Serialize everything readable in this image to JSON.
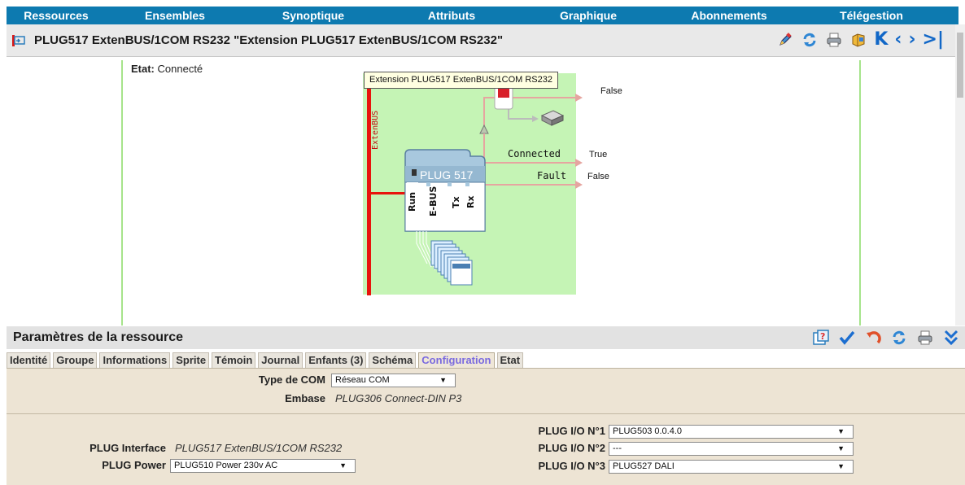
{
  "nav": {
    "items": [
      "Ressources",
      "Ensembles",
      "Synoptique",
      "Attributs",
      "Graphique",
      "Abonnements",
      "Télégestion"
    ]
  },
  "header": {
    "title": "PLUG517 ExtenBUS/1COM RS232 \"Extension PLUG517 ExtenBUS/1COM RS232\"",
    "icons": [
      "edit-icon",
      "refresh-icon",
      "print-icon",
      "export-icon",
      "first-icon",
      "prev-icon",
      "next-icon",
      "last-icon"
    ]
  },
  "status": {
    "label": "Etat:",
    "value": "Connecté"
  },
  "diagram": {
    "tooltip": "Extension PLUG517 ExtenBUS/1COM RS232",
    "bus_label": "ExtenBUS",
    "device_name": "PLUG 517",
    "ports": [
      "Run",
      "E-BUS",
      "Tx",
      "Rx"
    ],
    "signals": [
      {
        "name": "Connected",
        "value": "True"
      },
      {
        "name": "Fault",
        "value": "False"
      }
    ],
    "top_signal_value": "False",
    "colors": {
      "panel": "#c5f4b5",
      "bus": "#e8140c",
      "device": "#a8c8de"
    }
  },
  "params": {
    "title": "Paramètres de la ressource",
    "tabs": [
      "Identité",
      "Groupe",
      "Informations",
      "Sprite",
      "Témoin",
      "Journal",
      "Enfants (3)",
      "Schéma",
      "Configuration",
      "Etat"
    ],
    "active_tab": "Configuration",
    "type_com_label": "Type de COM",
    "type_com_value": "Réseau COM",
    "embase_label": "Embase",
    "embase_value": "PLUG306 Connect-DIN P3",
    "interface_label": "PLUG Interface",
    "interface_value": "PLUG517 ExtenBUS/1COM RS232",
    "power_label": "PLUG Power",
    "power_value": "PLUG510  Power 230v AC",
    "io": [
      {
        "label": "PLUG I/O N°1",
        "value": "PLUG503  0.0.4.0"
      },
      {
        "label": "PLUG I/O N°2",
        "value": "---"
      },
      {
        "label": "PLUG I/O N°3",
        "value": "PLUG527  DALI"
      }
    ]
  }
}
